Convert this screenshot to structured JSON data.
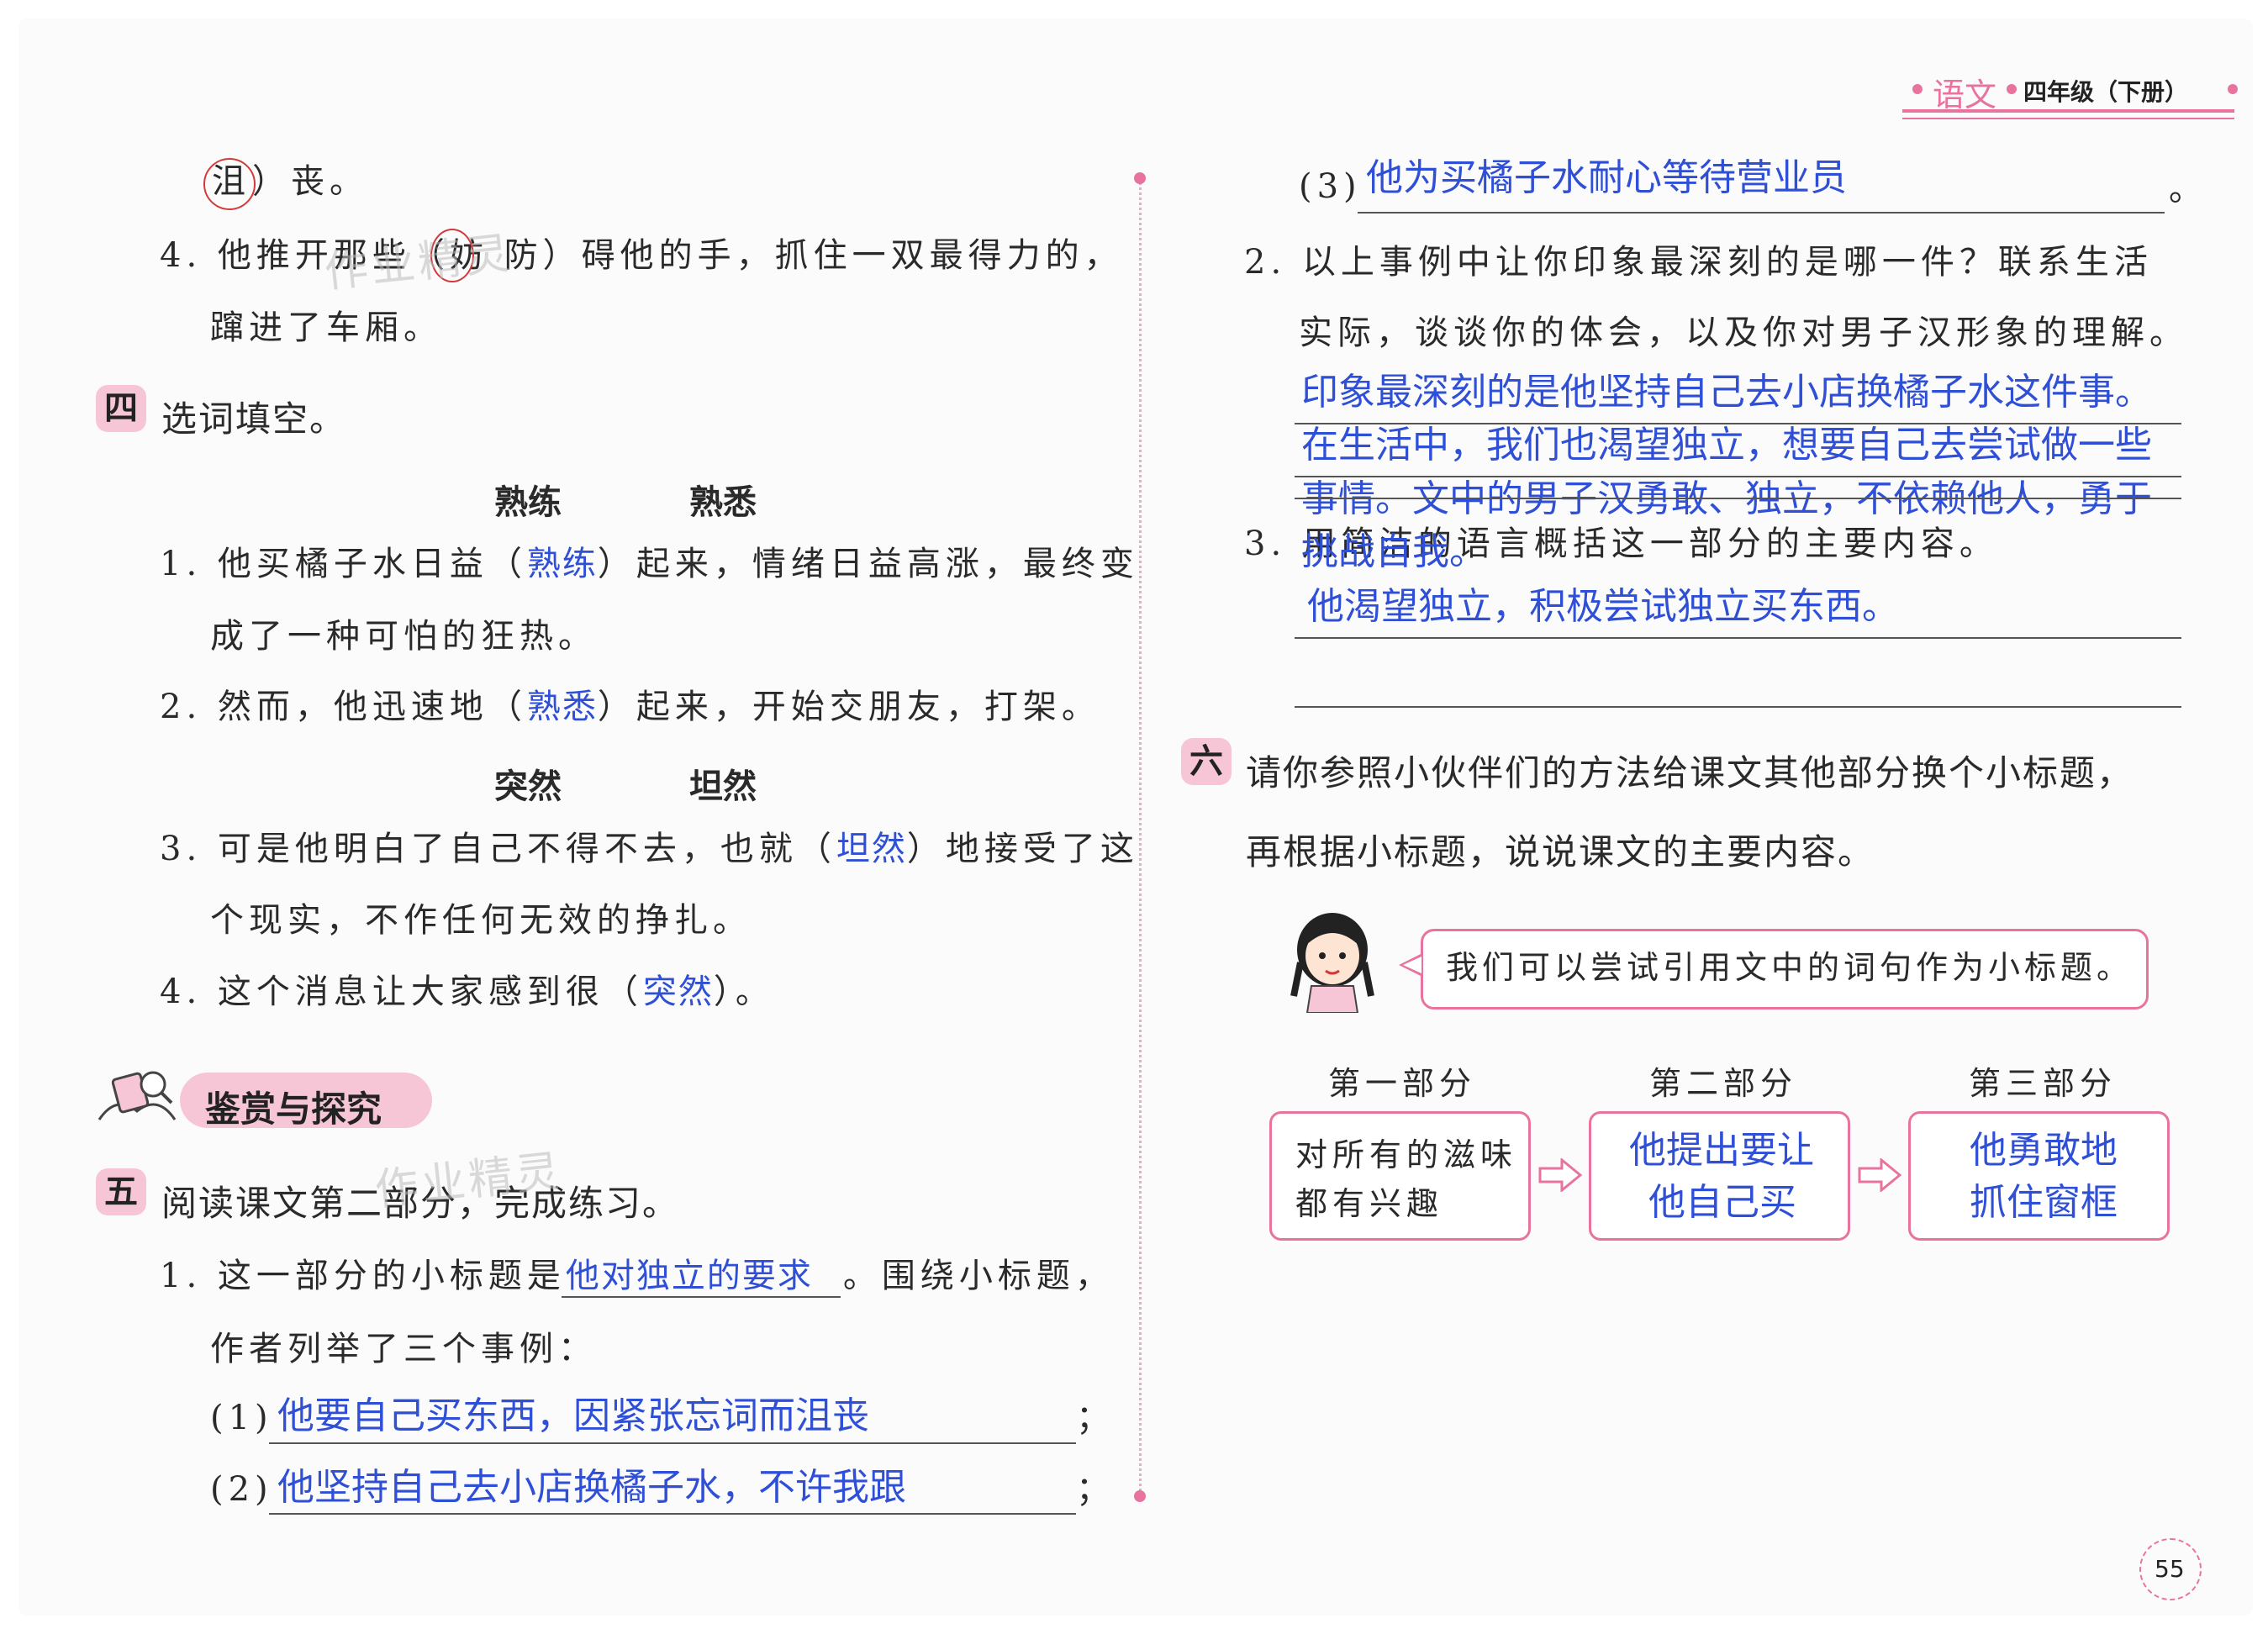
{
  "header": {
    "subject": "语文",
    "grade": "四年级（下册）"
  },
  "page_number": "55",
  "watermark": "作业精灵",
  "left": {
    "line_ju": {
      "circled": "沮",
      "rest": "）丧。"
    },
    "q4": {
      "prefix": "4. 他推开那些（妨  防）碍他的手，抓住一双最得力的，",
      "cont": "蹿进了车厢。"
    },
    "sec4": {
      "badge": "四",
      "title": "选词填空。"
    },
    "words1": [
      "熟练",
      "熟悉"
    ],
    "s1": {
      "a": "1. 他买橘子水日益（",
      "ans": "熟练",
      "b": "）起来，情绪日益高涨，最终变",
      "cont": "成了一种可怕的狂热。"
    },
    "s2": {
      "a": "2. 然而，他迅速地（",
      "ans": "熟悉",
      "b": "）起来，开始交朋友，打架。"
    },
    "words2": [
      "突然",
      "坦然"
    ],
    "s3": {
      "a": "3. 可是他明白了自己不得不去，也就（",
      "ans": "坦然",
      "b": "）地接受了这",
      "cont": "个现实，不作任何无效的挣扎。"
    },
    "s4": {
      "a": "4. 这个消息让大家感到很（",
      "ans": "突然",
      "b": "）。"
    },
    "banner": "鉴赏与探究",
    "sec5": {
      "badge": "五",
      "title": "阅读课文第二部分，完成练习。"
    },
    "q1": {
      "a": "1. 这一部分的小标题是",
      "ans": "他对独立的要求",
      "b": "。围绕小标题，",
      "cont": "作者列举了三个事例："
    },
    "ex1": {
      "num": "(1)",
      "ans": "他要自己买东西，因紧张忘词而沮丧",
      "end": "；"
    },
    "ex2": {
      "num": "(2)",
      "ans": "他坚持自己去小店换橘子水，不许我跟",
      "end": "；"
    }
  },
  "right": {
    "ex3": {
      "num": "(3)",
      "ans": "他为买橘子水耐心等待营业员",
      "end": "。"
    },
    "q2": {
      "a": "2. 以上事例中让你印象最深刻的是哪一件？联系生活",
      "b": "实际，谈谈你的体会，以及你对男子汉形象的理解。"
    },
    "q2_ans": [
      "印象最深刻的是他坚持自己去小店换橘子水这件事。",
      "在生活中，我们也渴望独立，想要自己去尝试做一些",
      "事情。文中的男子汉勇敢、独立，不依赖他人，勇于",
      "挑战自我。"
    ],
    "q3": {
      "a": "3. 用简洁的语言概括这一部分的主要内容。"
    },
    "q3_ans": "他渴望独立，积极尝试独立买东西。",
    "sec6": {
      "badge": "六",
      "line1": "请你参照小伙伴们的方法给课文其他部分换个小标题，",
      "line2": "再根据小标题，说说课文的主要内容。"
    },
    "speech": "我们可以尝试引用文中的词句作为小标题。",
    "parts": [
      {
        "label": "第一部分",
        "title1": "对所有的滋味",
        "title2": "都有兴趣"
      },
      {
        "label": "第二部分",
        "title1": "他提出要让",
        "title2": "他自己买"
      },
      {
        "label": "第三部分",
        "title1": "他勇敢地",
        "title2": "抓住窗框"
      }
    ]
  },
  "colors": {
    "accent_pink": "#e8739f",
    "badge_pink": "#f7c6d6",
    "answer_blue": "#2e4fd6"
  }
}
